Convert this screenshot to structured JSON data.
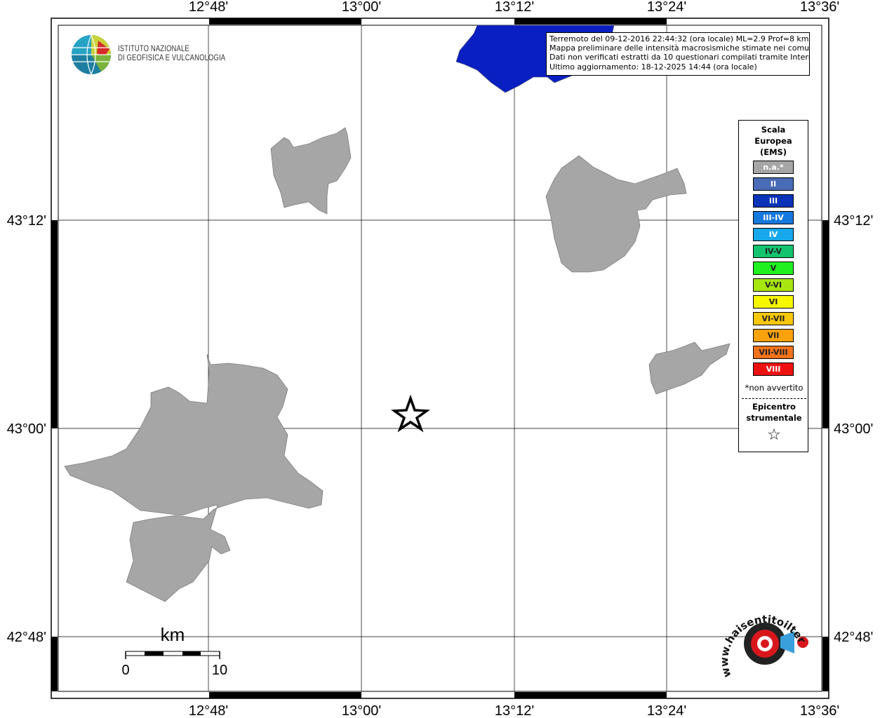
{
  "title_box": {
    "line1": "Terremoto del 09-12-2016 22:44:32 (ora locale) ML=2.9 Prof=8 km",
    "line2": "Mappa preliminare delle intensità macrosismiche stimate nei comuni",
    "line3": "Dati non verificati estratti da 10 questionari compilati tramite Internet.",
    "line4": "Ultimo aggiornamento: 18-12-2025 14:44 (ora locale)"
  },
  "axes": {
    "top_ticks": [
      "12°48'",
      "13°00'",
      "13°12'",
      "13°24'",
      "13°36'"
    ],
    "bottom_ticks": [
      "12°48'",
      "13°00'",
      "13°12'",
      "13°24'",
      "13°36'"
    ],
    "left_ticks": [
      "43°12'",
      "43°00'",
      "42°48'"
    ],
    "right_ticks": [
      "43°12'",
      "43°00'",
      "42°48'"
    ]
  },
  "logo": {
    "line1": "ISTITUTO NAZIONALE",
    "line2": "DI GEOFISICA E VULCANOLOGIA"
  },
  "legend": {
    "title1": "Scala",
    "title2": "Europea",
    "title3": "(EMS)",
    "items": [
      {
        "label": "n.a.*",
        "color": "#a6a6a6"
      },
      {
        "label": "II",
        "color": "#4a6bb5"
      },
      {
        "label": "III",
        "color": "#0a33b8"
      },
      {
        "label": "III-IV",
        "color": "#1478dc"
      },
      {
        "label": "IV",
        "color": "#16a8ea"
      },
      {
        "label": "IV-V",
        "color": "#13c36e"
      },
      {
        "label": "V",
        "color": "#20f020"
      },
      {
        "label": "V-VI",
        "color": "#a8e60f"
      },
      {
        "label": "VI",
        "color": "#f7f700"
      },
      {
        "label": "VI-VII",
        "color": "#f9c70a"
      },
      {
        "label": "VII",
        "color": "#faa20b"
      },
      {
        "label": "VII-VIII",
        "color": "#f2731a"
      },
      {
        "label": "VIII",
        "color": "#ee1111"
      }
    ],
    "note": "*non avvertito",
    "epicenter1": "Epicentro",
    "epicenter2": "strumentale",
    "epicenter_symbol": "☆"
  },
  "scalebar": {
    "unit": "km",
    "start": "0",
    "end": "10"
  },
  "hsi_logo": {
    "text": "www.haisentitoilterremoto.it"
  },
  "colors": {
    "area_na": "#a6a6a6",
    "area_iii": "#0a1fc2"
  }
}
